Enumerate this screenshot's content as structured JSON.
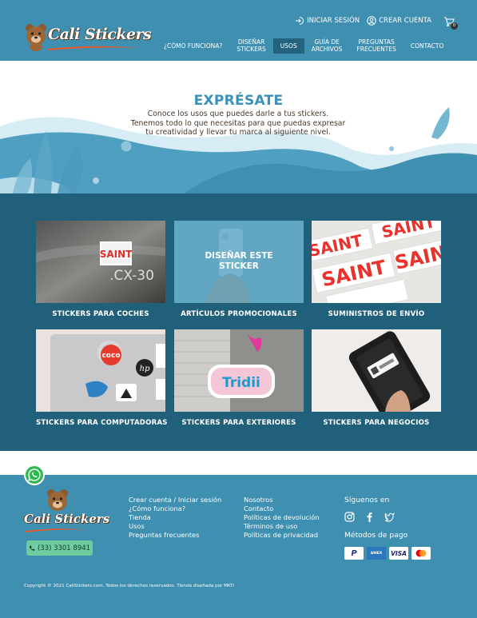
{
  "header": {
    "brand": "Cali Stickers",
    "login": "INICIAR SESIÓN",
    "register": "CREAR CUENTA",
    "cart_count": "0",
    "nav": [
      {
        "line1": "¿CÓMO FUNCIONA?",
        "line2": ""
      },
      {
        "line1": "DISEÑAR",
        "line2": "STICKERS"
      },
      {
        "line1": "USOS",
        "line2": ""
      },
      {
        "line1": "GUÍA DE",
        "line2": "ARCHIVOS"
      },
      {
        "line1": "PREGUNTAS",
        "line2": "FRECUENTES"
      },
      {
        "line1": "CONTACTO",
        "line2": ""
      }
    ]
  },
  "hero": {
    "title": "EXPRÉSATE",
    "line1": "Conoce los usos que puedes darle a tus stickers.",
    "line2": "Tenemos todo lo que necesitas para que puedas expresar",
    "line3": "tu creatividad y llevar tu marca al siguiente nivel."
  },
  "uses": {
    "overlay_line1": "DISEÑAR ESTE",
    "overlay_line2": "STICKER",
    "cards": [
      {
        "label": "STICKERS PARA COCHES",
        "image_text": ".CX-30",
        "sticker_text": "SAINT"
      },
      {
        "label": "ARTÍCULOS PROMOCIONALES"
      },
      {
        "label": "SUMINISTROS DE ENVÍO",
        "sticker_text": "SAINT"
      },
      {
        "label": "STICKERS PARA COMPUTADORAS",
        "sticker_text": "coco",
        "sticker_text2": "hp"
      },
      {
        "label": "STICKERS PARA EXTERIORES",
        "sticker_text": "Tridii"
      },
      {
        "label": "STICKERS PARA NEGOCIOS"
      }
    ]
  },
  "footer": {
    "brand": "Cali Stickers",
    "phone": "(33) 3301 8941",
    "col1": [
      "Crear cuenta / Iniciar sesión",
      "¿Cómo funciona?",
      "Tienda",
      "Usos",
      "Preguntas frecuentes"
    ],
    "col2": [
      "Nosotros",
      "Contacto",
      "Políticas de devolución",
      "Términos de uso",
      "Políticas de privacidad"
    ],
    "follow": "Síguenos en",
    "social_icons": [
      "instagram-icon",
      "facebook-icon",
      "twitter-icon"
    ],
    "payments_title": "Métodos de pago",
    "payments": [
      "PayPal",
      "AMEX",
      "VISA",
      "Mastercard"
    ],
    "copyright": "Copyright © 2021 CaliStickers.com. Todos los derechos reservados. Tienda diseñada por MKTi"
  },
  "colors": {
    "header_bg": "#3f8fb1",
    "nav_active": "#23637e",
    "uses_bg": "#21607a",
    "hero_title": "#3a90b6",
    "phone_button": "#6fcca0",
    "whatsapp": "#2fb84f"
  }
}
